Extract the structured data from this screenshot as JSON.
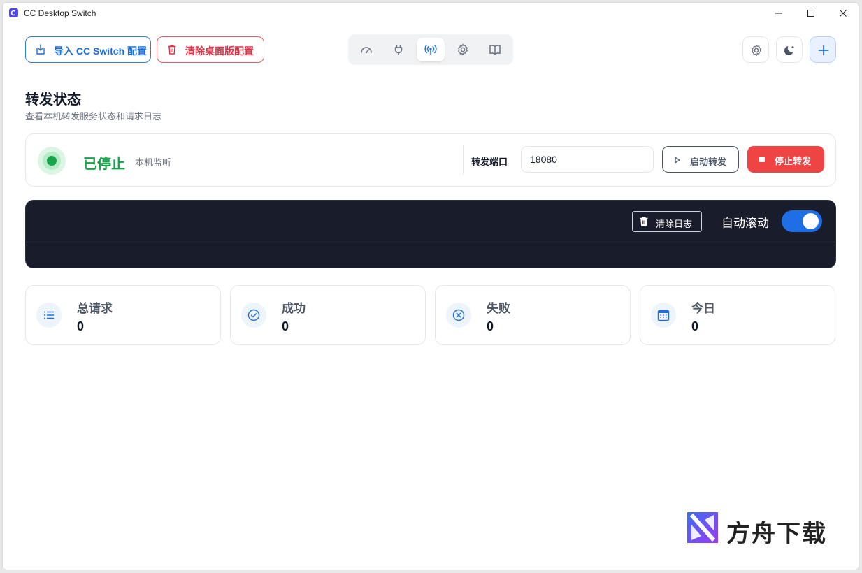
{
  "window": {
    "title": "CC Desktop Switch"
  },
  "toolbar": {
    "import_label": "导入 CC Switch 配置",
    "clear_label": "清除桌面版配置",
    "nav_icons": [
      "dashboard-icon",
      "plug-icon",
      "broadcast-icon",
      "settings-icon",
      "book-icon"
    ],
    "active_nav": "broadcast-icon"
  },
  "page": {
    "title": "转发状态",
    "subtitle": "查看本机转发服务状态和请求日志"
  },
  "status": {
    "state_text": "已停止",
    "mode_text": "本机监听",
    "port_label": "转发端口",
    "port_value": "18080",
    "start_label": "启动转发",
    "stop_label": "停止转发",
    "state_color": "#16a34a"
  },
  "log": {
    "clear_label": "清除日志",
    "autoscroll_label": "自动滚动",
    "autoscroll_on": true
  },
  "stats": [
    {
      "label": "总请求",
      "value": "0",
      "icon": "list-icon"
    },
    {
      "label": "成功",
      "value": "0",
      "icon": "check-circle-icon"
    },
    {
      "label": "失败",
      "value": "0",
      "icon": "x-circle-icon"
    },
    {
      "label": "今日",
      "value": "0",
      "icon": "calendar-icon"
    }
  ],
  "watermark": {
    "text": "方舟下载"
  },
  "colors": {
    "accent": "#1e6fd9",
    "danger": "#ef4444",
    "log_bg": "#181c2b"
  }
}
